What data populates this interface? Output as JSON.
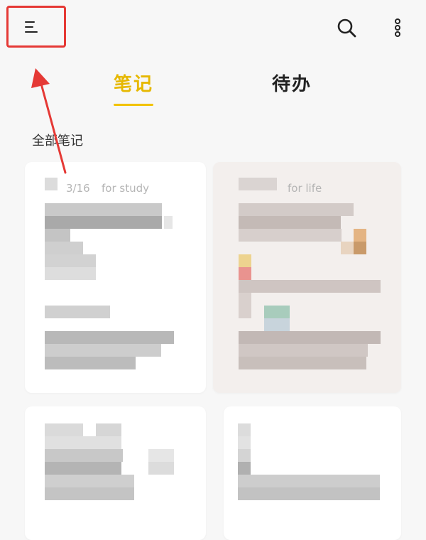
{
  "header": {
    "menu_icon": "hamburger-menu-icon",
    "search_icon": "search-icon",
    "more_icon": "more-vertical-icon"
  },
  "tabs": [
    {
      "label": "笔记",
      "active": true
    },
    {
      "label": "待办",
      "active": false
    }
  ],
  "section_label": "全部笔记",
  "notes": [
    {
      "date": "3/16",
      "tag": "for study"
    },
    {
      "date": "",
      "tag": "for life"
    },
    {
      "date": "",
      "tag": ""
    },
    {
      "date": "",
      "tag": ""
    }
  ],
  "colors": {
    "accent": "#f2c200",
    "annotation": "#e53935"
  }
}
